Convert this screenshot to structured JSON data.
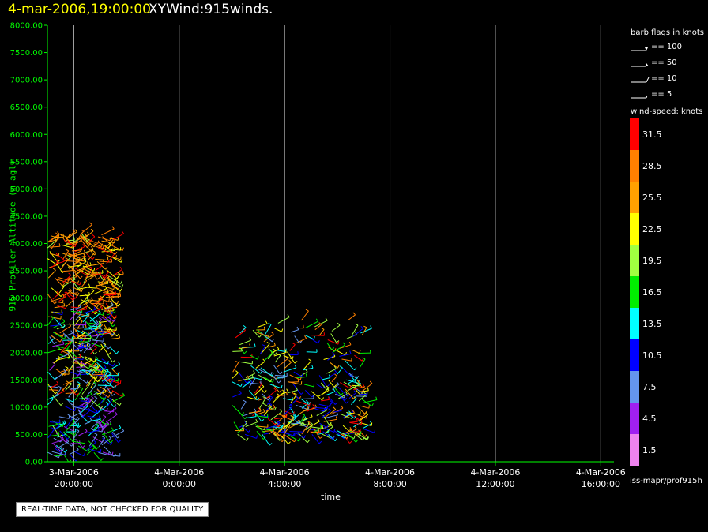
{
  "title": {
    "date": "4-mar-2006,19:00:00",
    "name": "XYWind:915winds."
  },
  "notice": "REAL-TIME DATA, NOT CHECKED FOR QUALITY",
  "legend": {
    "barb_header": "barb flags in knots",
    "barbs": [
      "== 100",
      "== 50",
      "== 10",
      "== 5"
    ],
    "speed_header": "wind-speed: knots",
    "colorbar": [
      {
        "label": "31.5",
        "color": "#ff0000"
      },
      {
        "label": "28.5",
        "color": "#ff8000"
      },
      {
        "label": "25.5",
        "color": "#ffa000"
      },
      {
        "label": "22.5",
        "color": "#ffff00"
      },
      {
        "label": "19.5",
        "color": "#a0ff40"
      },
      {
        "label": "16.5",
        "color": "#00ee00"
      },
      {
        "label": "13.5",
        "color": "#00ffff"
      },
      {
        "label": "10.5",
        "color": "#0000ff"
      },
      {
        "label": "7.5",
        "color": "#6495ed"
      },
      {
        "label": "4.5",
        "color": "#a020f0"
      },
      {
        "label": "1.5",
        "color": "#ee82ee"
      }
    ],
    "footer": "iss-mapr/prof915h"
  },
  "chart_data": {
    "type": "scatter",
    "ylabel": "915 Profiler Altitude (m agl)",
    "xlabel": "time",
    "ylim": [
      0,
      8000
    ],
    "xlim": [
      -1.0,
      20.5
    ],
    "y_ticks": [
      "0.00",
      "500.00",
      "1000.00",
      "1500.00",
      "2000.00",
      "2500.00",
      "3000.00",
      "3500.00",
      "4000.00",
      "4500.00",
      "5000.00",
      "5500.00",
      "6000.00",
      "6500.00",
      "7000.00",
      "7500.00",
      "8000.00"
    ],
    "x_ticks": [
      {
        "hours": 0,
        "date": "3-Mar-2006",
        "time": "20:00:00"
      },
      {
        "hours": 4,
        "date": "4-Mar-2006",
        "time": "0:00:00"
      },
      {
        "hours": 8,
        "date": "4-Mar-2006",
        "time": "4:00:00"
      },
      {
        "hours": 12,
        "date": "4-Mar-2006",
        "time": "8:00:00"
      },
      {
        "hours": 16,
        "date": "4-Mar-2006",
        "time": "12:00:00"
      },
      {
        "hours": 20,
        "date": "4-Mar-2006",
        "time": "16:00:00"
      }
    ],
    "grid": "vertical",
    "clusters": [
      {
        "time_range": [
          "3-Mar-2006 19:00",
          "3-Mar-2006 21:30"
        ],
        "alt_range": [
          100,
          4200
        ],
        "speed_range": [
          4.5,
          31.5
        ]
      },
      {
        "time_range": [
          "4-Mar-2006 2:00",
          "4-Mar-2006 7:00"
        ],
        "alt_range": [
          500,
          2600
        ],
        "speed_range": [
          7.5,
          31.5
        ]
      }
    ]
  }
}
